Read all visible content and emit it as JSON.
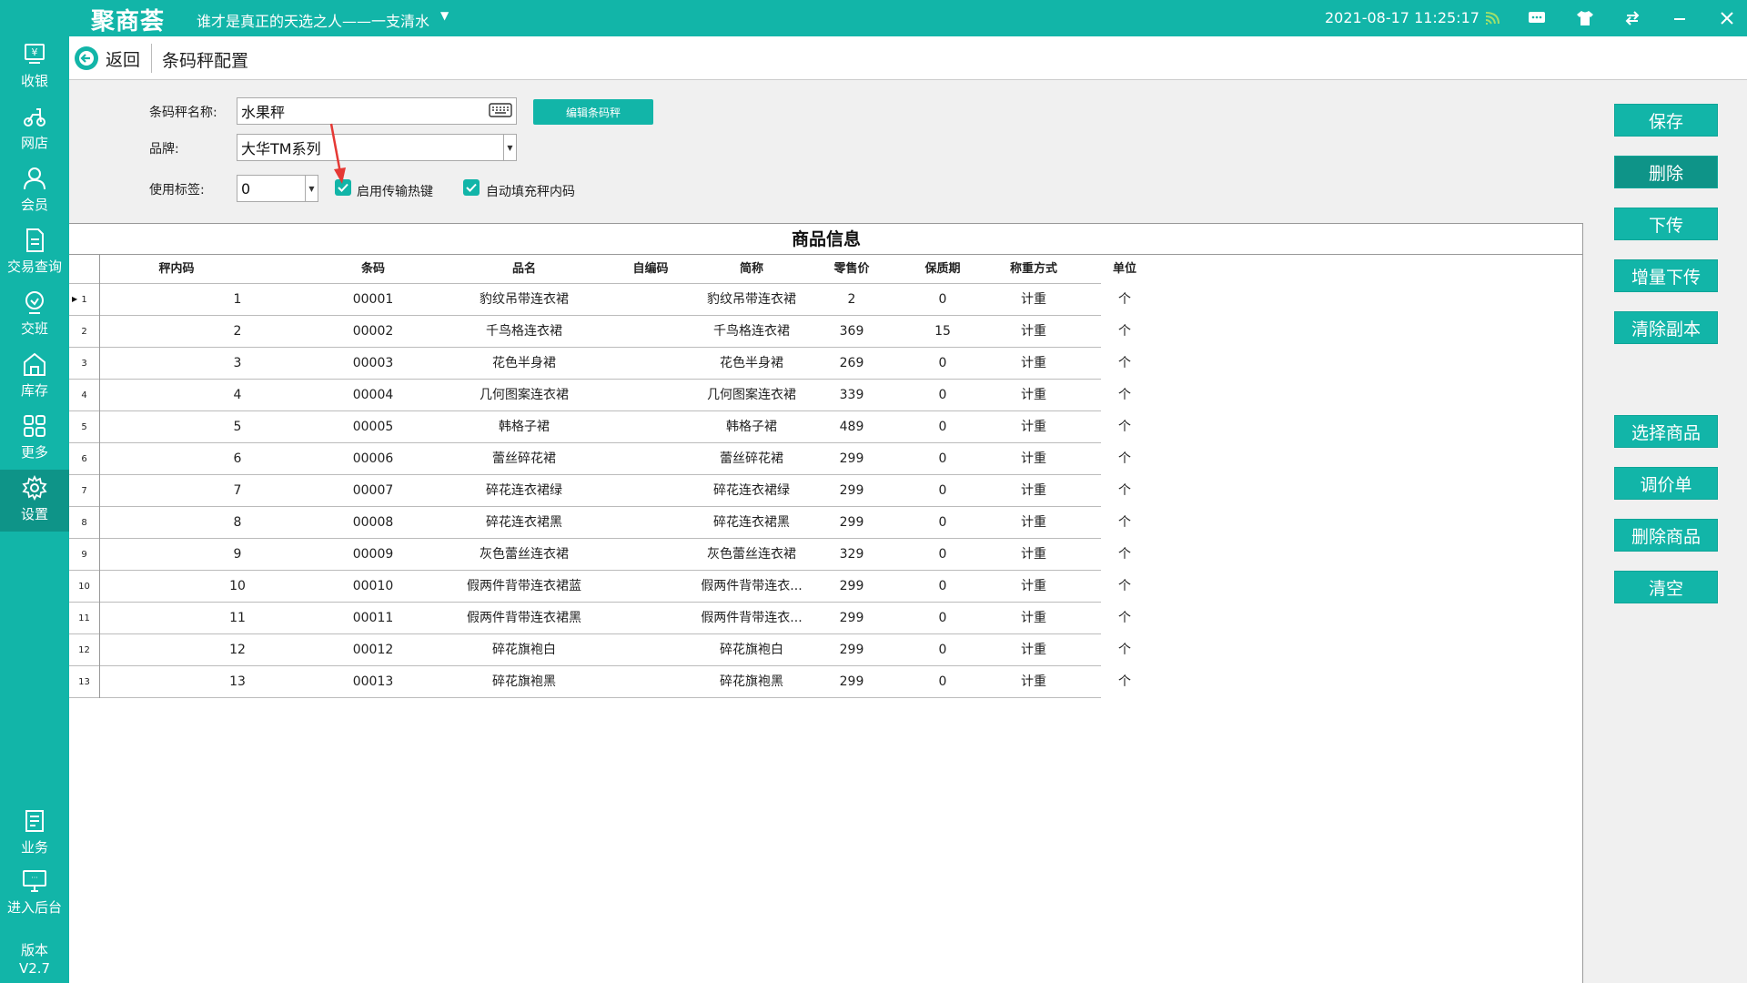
{
  "app": {
    "logo": "聚商荟",
    "shop_name": "谁才是真正的天选之人——一支清水",
    "datetime": "2021-08-17 11:25:17"
  },
  "sidebar": {
    "items": [
      {
        "label": "收银",
        "icon": "cashier-icon"
      },
      {
        "label": "网店",
        "icon": "scooter-icon"
      },
      {
        "label": "会员",
        "icon": "member-icon"
      },
      {
        "label": "交易查询",
        "icon": "document-icon"
      },
      {
        "label": "交班",
        "icon": "handover-icon"
      },
      {
        "label": "库存",
        "icon": "warehouse-icon"
      },
      {
        "label": "更多",
        "icon": "grid-icon"
      },
      {
        "label": "设置",
        "icon": "gear-icon"
      },
      {
        "label": "业务",
        "icon": "business-icon"
      },
      {
        "label": "进入后台",
        "icon": "monitor-icon"
      }
    ],
    "version_label": "版本",
    "version": "V2.7"
  },
  "header": {
    "back_label": "返回",
    "title": "条码秤配置"
  },
  "form": {
    "name_label": "条码秤名称:",
    "name_value": "水果秤",
    "brand_label": "品牌:",
    "brand_value": "大华TM系列",
    "tag_label": "使用标签:",
    "tag_value": "0",
    "edit_button": "编辑条码秤",
    "hotkey_label": "启用传输热键",
    "autofill_label": "自动填充秤内码"
  },
  "table": {
    "title": "商品信息",
    "columns": [
      "秤内码",
      "条码",
      "品名",
      "自编码",
      "简称",
      "零售价",
      "保质期",
      "称重方式",
      "单位"
    ],
    "rows": [
      {
        "idx": "1",
        "plu": "1",
        "barcode": "00001",
        "name": "豹纹吊带连衣裙",
        "selfcode": "",
        "short": "豹纹吊带连衣裙",
        "price": "2",
        "shelf": "0",
        "weigh": "计重",
        "unit": "个"
      },
      {
        "idx": "2",
        "plu": "2",
        "barcode": "00002",
        "name": "千鸟格连衣裙",
        "selfcode": "",
        "short": "千鸟格连衣裙",
        "price": "369",
        "shelf": "15",
        "weigh": "计重",
        "unit": "个"
      },
      {
        "idx": "3",
        "plu": "3",
        "barcode": "00003",
        "name": "花色半身裙",
        "selfcode": "",
        "short": "花色半身裙",
        "price": "269",
        "shelf": "0",
        "weigh": "计重",
        "unit": "个"
      },
      {
        "idx": "4",
        "plu": "4",
        "barcode": "00004",
        "name": "几何图案连衣裙",
        "selfcode": "",
        "short": "几何图案连衣裙",
        "price": "339",
        "shelf": "0",
        "weigh": "计重",
        "unit": "个"
      },
      {
        "idx": "5",
        "plu": "5",
        "barcode": "00005",
        "name": "韩格子裙",
        "selfcode": "",
        "short": "韩格子裙",
        "price": "489",
        "shelf": "0",
        "weigh": "计重",
        "unit": "个"
      },
      {
        "idx": "6",
        "plu": "6",
        "barcode": "00006",
        "name": "蕾丝碎花裙",
        "selfcode": "",
        "short": "蕾丝碎花裙",
        "price": "299",
        "shelf": "0",
        "weigh": "计重",
        "unit": "个"
      },
      {
        "idx": "7",
        "plu": "7",
        "barcode": "00007",
        "name": "碎花连衣裙绿",
        "selfcode": "",
        "short": "碎花连衣裙绿",
        "price": "299",
        "shelf": "0",
        "weigh": "计重",
        "unit": "个"
      },
      {
        "idx": "8",
        "plu": "8",
        "barcode": "00008",
        "name": "碎花连衣裙黑",
        "selfcode": "",
        "short": "碎花连衣裙黑",
        "price": "299",
        "shelf": "0",
        "weigh": "计重",
        "unit": "个"
      },
      {
        "idx": "9",
        "plu": "9",
        "barcode": "00009",
        "name": "灰色蕾丝连衣裙",
        "selfcode": "",
        "short": "灰色蕾丝连衣裙",
        "price": "329",
        "shelf": "0",
        "weigh": "计重",
        "unit": "个"
      },
      {
        "idx": "10",
        "plu": "10",
        "barcode": "00010",
        "name": "假两件背带连衣裙蓝",
        "selfcode": "",
        "short": "假两件背带连衣...",
        "price": "299",
        "shelf": "0",
        "weigh": "计重",
        "unit": "个"
      },
      {
        "idx": "11",
        "plu": "11",
        "barcode": "00011",
        "name": "假两件背带连衣裙黑",
        "selfcode": "",
        "short": "假两件背带连衣...",
        "price": "299",
        "shelf": "0",
        "weigh": "计重",
        "unit": "个"
      },
      {
        "idx": "12",
        "plu": "12",
        "barcode": "00012",
        "name": "碎花旗袍白",
        "selfcode": "",
        "short": "碎花旗袍白",
        "price": "299",
        "shelf": "0",
        "weigh": "计重",
        "unit": "个"
      },
      {
        "idx": "13",
        "plu": "13",
        "barcode": "00013",
        "name": "碎花旗袍黑",
        "selfcode": "",
        "short": "碎花旗袍黑",
        "price": "299",
        "shelf": "0",
        "weigh": "计重",
        "unit": "个"
      }
    ]
  },
  "actions": {
    "save": "保存",
    "delete": "删除",
    "download": "下传",
    "incremental_download": "增量下传",
    "clear_copy": "清除副本",
    "select_goods": "选择商品",
    "price_adjust": "调价单",
    "delete_goods": "删除商品",
    "clear": "清空"
  },
  "colors": {
    "accent": "#12b5a8",
    "accent_dark": "#0e9488",
    "arrow": "#e53935"
  }
}
